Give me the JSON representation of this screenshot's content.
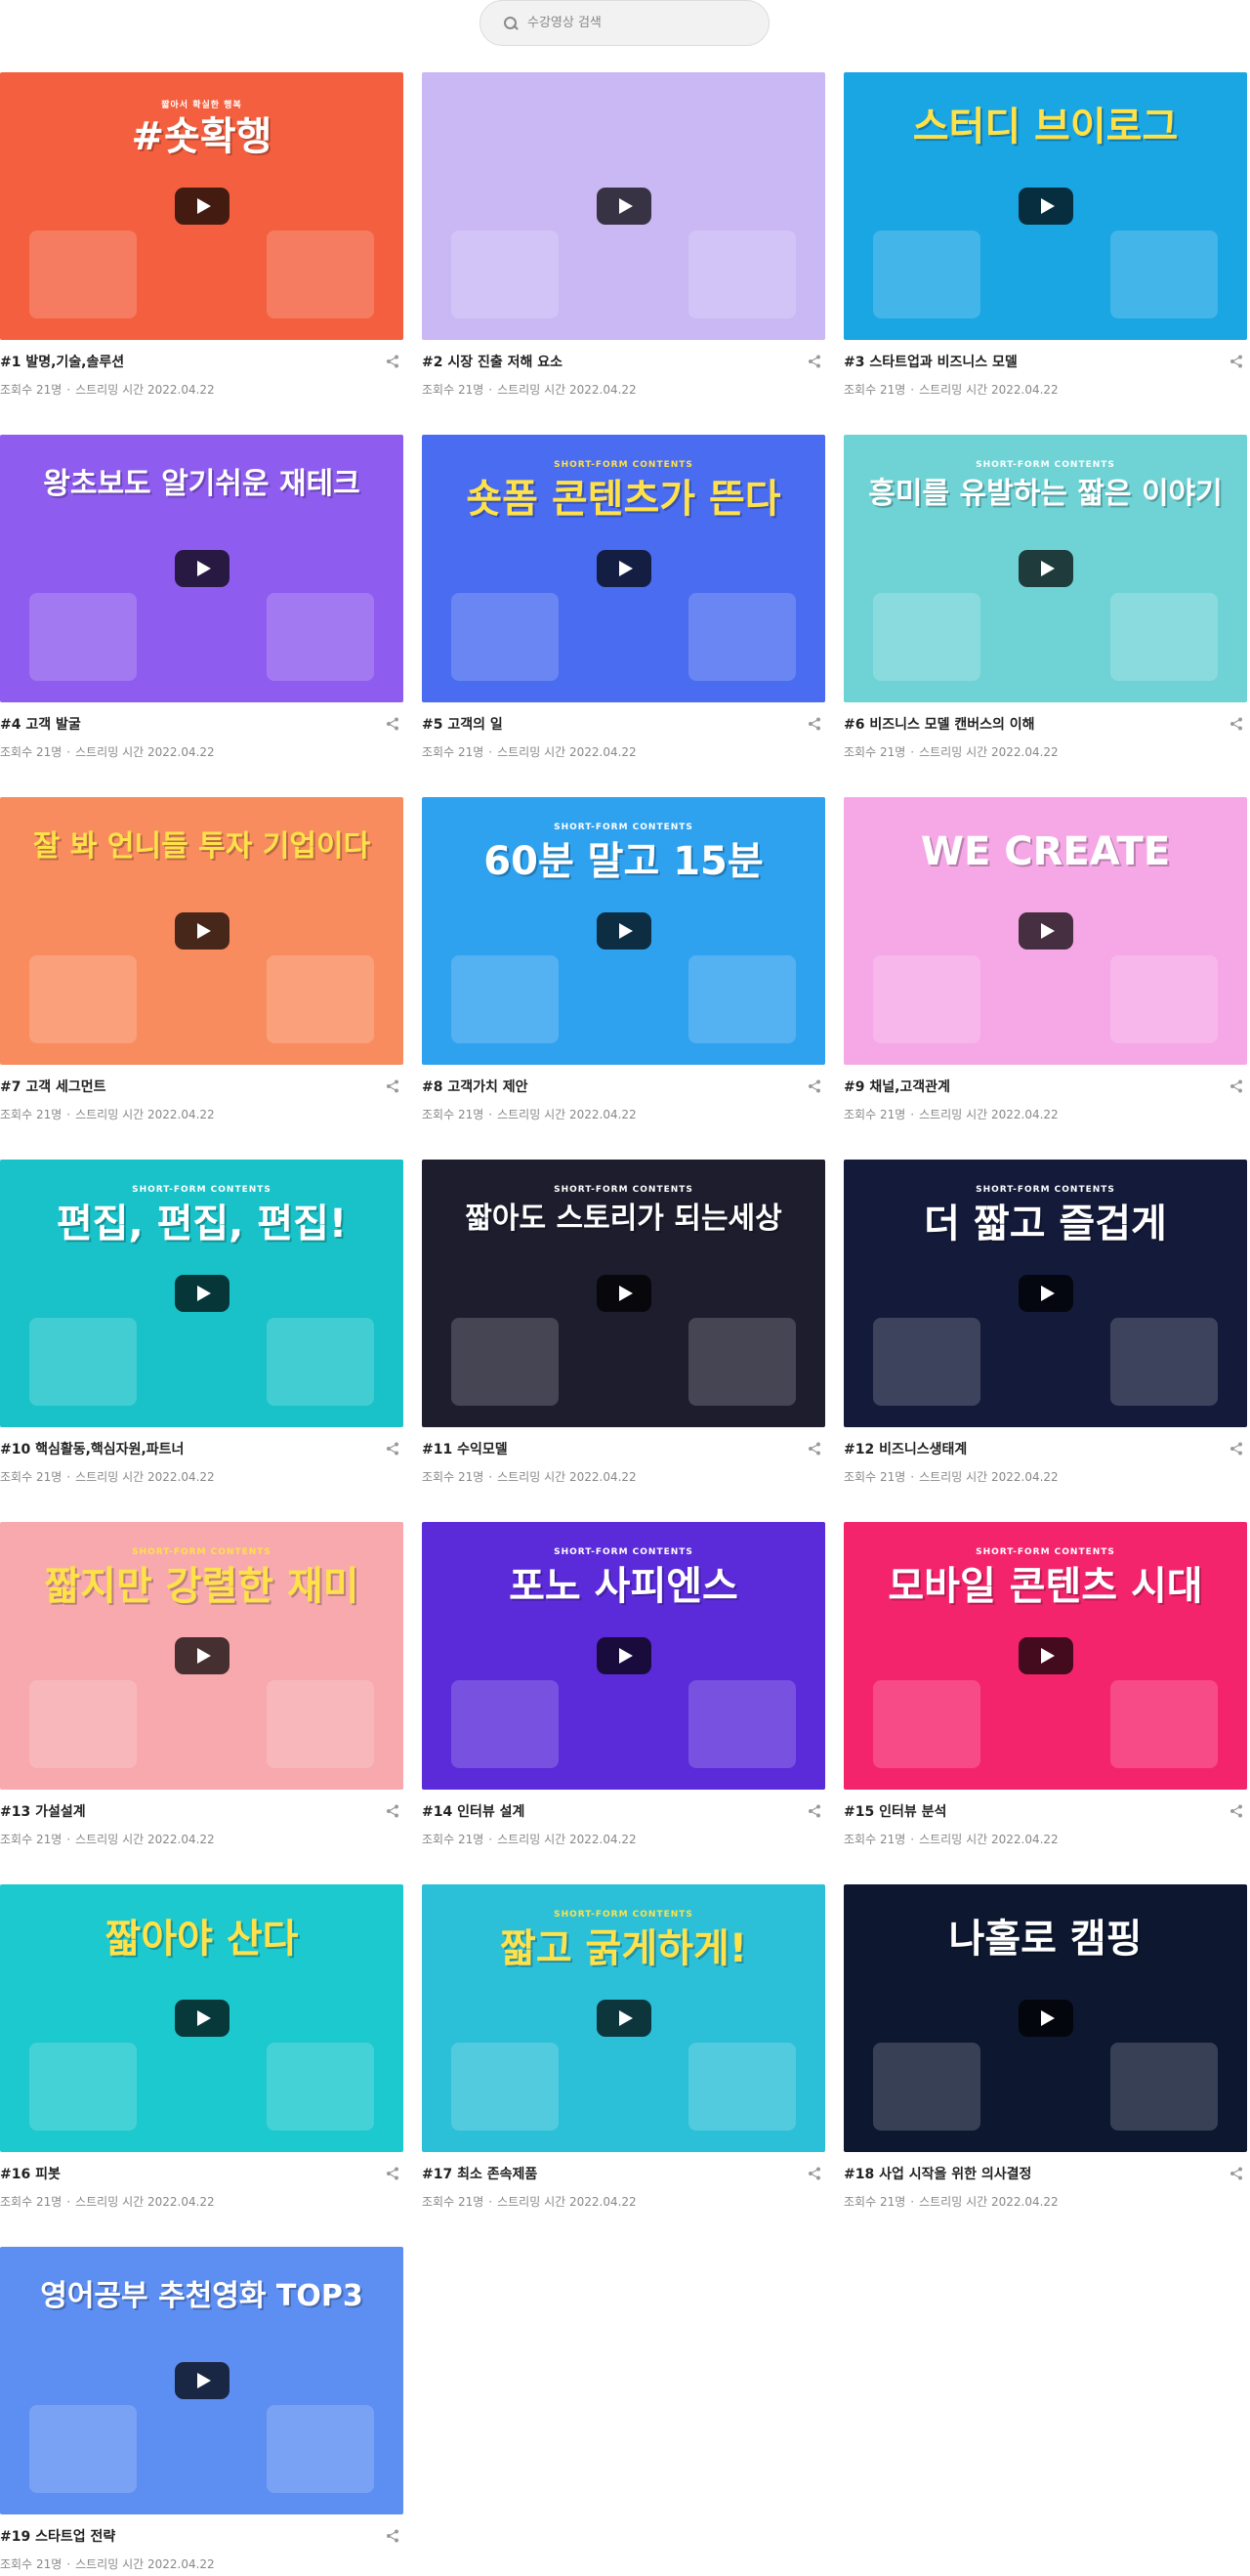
{
  "search": {
    "placeholder": "수강영상 검색"
  },
  "meta_labels": {
    "views_prefix": "조회수",
    "streaming_prefix": "스트리밍 시간"
  },
  "icons": {
    "search": "search-icon",
    "share": "share-icon",
    "play": "play-icon"
  },
  "videos": [
    {
      "title": "#1 발명,기술,솔루션",
      "views": "21명",
      "date": "2022.04.22",
      "thumb_text": "#숏확행",
      "thumb_sub": "짧아서 확실한 행복",
      "bg": "#f4603f",
      "fg": "#ffffff"
    },
    {
      "title": "#2 시장 진출 저해 요소",
      "views": "21명",
      "date": "2022.04.22",
      "thumb_text": "",
      "thumb_sub": "",
      "bg": "#c9b8f4",
      "fg": "#ffffff"
    },
    {
      "title": "#3 스타트업과 비즈니스 모델",
      "views": "21명",
      "date": "2022.04.22",
      "thumb_text": "스터디 브이로그",
      "thumb_sub": "",
      "bg": "#1aa5e3",
      "fg": "#ffe14a"
    },
    {
      "title": "#4 고객 발굴",
      "views": "21명",
      "date": "2022.04.22",
      "thumb_text": "왕초보도 알기쉬운 재테크",
      "thumb_sub": "",
      "bg": "#8f5cf0",
      "fg": "#ffffff"
    },
    {
      "title": "#5 고객의 일",
      "views": "21명",
      "date": "2022.04.22",
      "thumb_text": "숏폼 콘텐츠가 뜬다",
      "thumb_sub": "SHORT-FORM CONTENTS",
      "bg": "#4a6cf0",
      "fg": "#ffe14a"
    },
    {
      "title": "#6 비즈니스 모델 캔버스의 이해",
      "views": "21명",
      "date": "2022.04.22",
      "thumb_text": "흥미를 유발하는 짧은 이야기",
      "thumb_sub": "SHORT-FORM CONTENTS",
      "bg": "#6fd3d6",
      "fg": "#ffffff"
    },
    {
      "title": "#7 고객 세그먼트",
      "views": "21명",
      "date": "2022.04.22",
      "thumb_text": "잘 봐 언니들 투자 기업이다",
      "thumb_sub": "",
      "bg": "#f98c5f",
      "fg": "#ffe14a"
    },
    {
      "title": "#8 고객가치 제안",
      "views": "21명",
      "date": "2022.04.22",
      "thumb_text": "60분 말고 15분",
      "thumb_sub": "SHORT-FORM CONTENTS",
      "bg": "#2fa2ef",
      "fg": "#ffffff"
    },
    {
      "title": "#9 채널,고객관계",
      "views": "21명",
      "date": "2022.04.22",
      "thumb_text": "WE CREATE",
      "thumb_sub": "",
      "bg": "#f6a8e6",
      "fg": "#ffffff"
    },
    {
      "title": "#10 핵심활동,핵심자원,파트너",
      "views": "21명",
      "date": "2022.04.22",
      "thumb_text": "편집, 편집, 편집!",
      "thumb_sub": "SHORT-FORM CONTENTS",
      "bg": "#19c2c8",
      "fg": "#ffffff"
    },
    {
      "title": "#11 수익모델",
      "views": "21명",
      "date": "2022.04.22",
      "thumb_text": "짧아도 스토리가 되는세상",
      "thumb_sub": "SHORT-FORM CONTENTS",
      "bg": "#1d1d2e",
      "fg": "#ffffff"
    },
    {
      "title": "#12 비즈니스생태계",
      "views": "21명",
      "date": "2022.04.22",
      "thumb_text": "더 짧고 즐겁게",
      "thumb_sub": "SHORT-FORM CONTENTS",
      "bg": "#141a3a",
      "fg": "#ffffff"
    },
    {
      "title": "#13 가설설계",
      "views": "21명",
      "date": "2022.04.22",
      "thumb_text": "짧지만 강렬한 재미",
      "thumb_sub": "SHORT-FORM CONTENTS",
      "bg": "#f7a9ad",
      "fg": "#ffe14a"
    },
    {
      "title": "#14 인터뷰 설계",
      "views": "21명",
      "date": "2022.04.22",
      "thumb_text": "포노 사피엔스",
      "thumb_sub": "SHORT-FORM CONTENTS",
      "bg": "#5b2bd9",
      "fg": "#ffffff"
    },
    {
      "title": "#15 인터뷰 분석",
      "views": "21명",
      "date": "2022.04.22",
      "thumb_text": "모바일 콘텐츠 시대",
      "thumb_sub": "SHORT-FORM CONTENTS",
      "bg": "#f4246c",
      "fg": "#ffffff"
    },
    {
      "title": "#16 피봇",
      "views": "21명",
      "date": "2022.04.22",
      "thumb_text": "짧아야 산다",
      "thumb_sub": "",
      "bg": "#1bc9cf",
      "fg": "#ffe14a"
    },
    {
      "title": "#17 최소 존속제품",
      "views": "21명",
      "date": "2022.04.22",
      "thumb_text": "짧고 굵게하게!",
      "thumb_sub": "SHORT-FORM CONTENTS",
      "bg": "#2cc0d8",
      "fg": "#ffe14a"
    },
    {
      "title": "#18 사업 시작을 위한 의사결정",
      "views": "21명",
      "date": "2022.04.22",
      "thumb_text": "나홀로 캠핑",
      "thumb_sub": "",
      "bg": "#0d1730",
      "fg": "#ffffff"
    },
    {
      "title": "#19 스타트업 전략",
      "views": "21명",
      "date": "2022.04.22",
      "thumb_text": "영어공부 추천영화 TOP3",
      "thumb_sub": "",
      "bg": "#5d8ef2",
      "fg": "#ffffff"
    }
  ]
}
